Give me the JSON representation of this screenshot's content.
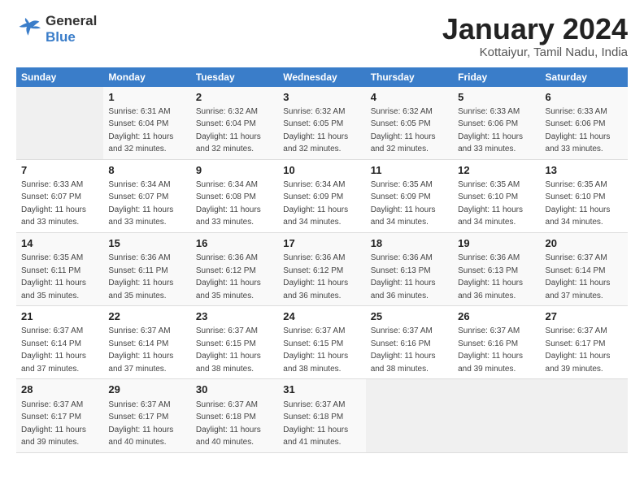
{
  "header": {
    "logo_line1": "General",
    "logo_line2": "Blue",
    "month_title": "January 2024",
    "subtitle": "Kottaiyur, Tamil Nadu, India"
  },
  "weekdays": [
    "Sunday",
    "Monday",
    "Tuesday",
    "Wednesday",
    "Thursday",
    "Friday",
    "Saturday"
  ],
  "weeks": [
    [
      {
        "num": "",
        "empty": true
      },
      {
        "num": "1",
        "sunrise": "Sunrise: 6:31 AM",
        "sunset": "Sunset: 6:04 PM",
        "daylight": "Daylight: 11 hours and 32 minutes."
      },
      {
        "num": "2",
        "sunrise": "Sunrise: 6:32 AM",
        "sunset": "Sunset: 6:04 PM",
        "daylight": "Daylight: 11 hours and 32 minutes."
      },
      {
        "num": "3",
        "sunrise": "Sunrise: 6:32 AM",
        "sunset": "Sunset: 6:05 PM",
        "daylight": "Daylight: 11 hours and 32 minutes."
      },
      {
        "num": "4",
        "sunrise": "Sunrise: 6:32 AM",
        "sunset": "Sunset: 6:05 PM",
        "daylight": "Daylight: 11 hours and 32 minutes."
      },
      {
        "num": "5",
        "sunrise": "Sunrise: 6:33 AM",
        "sunset": "Sunset: 6:06 PM",
        "daylight": "Daylight: 11 hours and 33 minutes."
      },
      {
        "num": "6",
        "sunrise": "Sunrise: 6:33 AM",
        "sunset": "Sunset: 6:06 PM",
        "daylight": "Daylight: 11 hours and 33 minutes."
      }
    ],
    [
      {
        "num": "7",
        "sunrise": "Sunrise: 6:33 AM",
        "sunset": "Sunset: 6:07 PM",
        "daylight": "Daylight: 11 hours and 33 minutes."
      },
      {
        "num": "8",
        "sunrise": "Sunrise: 6:34 AM",
        "sunset": "Sunset: 6:07 PM",
        "daylight": "Daylight: 11 hours and 33 minutes."
      },
      {
        "num": "9",
        "sunrise": "Sunrise: 6:34 AM",
        "sunset": "Sunset: 6:08 PM",
        "daylight": "Daylight: 11 hours and 33 minutes."
      },
      {
        "num": "10",
        "sunrise": "Sunrise: 6:34 AM",
        "sunset": "Sunset: 6:09 PM",
        "daylight": "Daylight: 11 hours and 34 minutes."
      },
      {
        "num": "11",
        "sunrise": "Sunrise: 6:35 AM",
        "sunset": "Sunset: 6:09 PM",
        "daylight": "Daylight: 11 hours and 34 minutes."
      },
      {
        "num": "12",
        "sunrise": "Sunrise: 6:35 AM",
        "sunset": "Sunset: 6:10 PM",
        "daylight": "Daylight: 11 hours and 34 minutes."
      },
      {
        "num": "13",
        "sunrise": "Sunrise: 6:35 AM",
        "sunset": "Sunset: 6:10 PM",
        "daylight": "Daylight: 11 hours and 34 minutes."
      }
    ],
    [
      {
        "num": "14",
        "sunrise": "Sunrise: 6:35 AM",
        "sunset": "Sunset: 6:11 PM",
        "daylight": "Daylight: 11 hours and 35 minutes."
      },
      {
        "num": "15",
        "sunrise": "Sunrise: 6:36 AM",
        "sunset": "Sunset: 6:11 PM",
        "daylight": "Daylight: 11 hours and 35 minutes."
      },
      {
        "num": "16",
        "sunrise": "Sunrise: 6:36 AM",
        "sunset": "Sunset: 6:12 PM",
        "daylight": "Daylight: 11 hours and 35 minutes."
      },
      {
        "num": "17",
        "sunrise": "Sunrise: 6:36 AM",
        "sunset": "Sunset: 6:12 PM",
        "daylight": "Daylight: 11 hours and 36 minutes."
      },
      {
        "num": "18",
        "sunrise": "Sunrise: 6:36 AM",
        "sunset": "Sunset: 6:13 PM",
        "daylight": "Daylight: 11 hours and 36 minutes."
      },
      {
        "num": "19",
        "sunrise": "Sunrise: 6:36 AM",
        "sunset": "Sunset: 6:13 PM",
        "daylight": "Daylight: 11 hours and 36 minutes."
      },
      {
        "num": "20",
        "sunrise": "Sunrise: 6:37 AM",
        "sunset": "Sunset: 6:14 PM",
        "daylight": "Daylight: 11 hours and 37 minutes."
      }
    ],
    [
      {
        "num": "21",
        "sunrise": "Sunrise: 6:37 AM",
        "sunset": "Sunset: 6:14 PM",
        "daylight": "Daylight: 11 hours and 37 minutes."
      },
      {
        "num": "22",
        "sunrise": "Sunrise: 6:37 AM",
        "sunset": "Sunset: 6:14 PM",
        "daylight": "Daylight: 11 hours and 37 minutes."
      },
      {
        "num": "23",
        "sunrise": "Sunrise: 6:37 AM",
        "sunset": "Sunset: 6:15 PM",
        "daylight": "Daylight: 11 hours and 38 minutes."
      },
      {
        "num": "24",
        "sunrise": "Sunrise: 6:37 AM",
        "sunset": "Sunset: 6:15 PM",
        "daylight": "Daylight: 11 hours and 38 minutes."
      },
      {
        "num": "25",
        "sunrise": "Sunrise: 6:37 AM",
        "sunset": "Sunset: 6:16 PM",
        "daylight": "Daylight: 11 hours and 38 minutes."
      },
      {
        "num": "26",
        "sunrise": "Sunrise: 6:37 AM",
        "sunset": "Sunset: 6:16 PM",
        "daylight": "Daylight: 11 hours and 39 minutes."
      },
      {
        "num": "27",
        "sunrise": "Sunrise: 6:37 AM",
        "sunset": "Sunset: 6:17 PM",
        "daylight": "Daylight: 11 hours and 39 minutes."
      }
    ],
    [
      {
        "num": "28",
        "sunrise": "Sunrise: 6:37 AM",
        "sunset": "Sunset: 6:17 PM",
        "daylight": "Daylight: 11 hours and 39 minutes."
      },
      {
        "num": "29",
        "sunrise": "Sunrise: 6:37 AM",
        "sunset": "Sunset: 6:17 PM",
        "daylight": "Daylight: 11 hours and 40 minutes."
      },
      {
        "num": "30",
        "sunrise": "Sunrise: 6:37 AM",
        "sunset": "Sunset: 6:18 PM",
        "daylight": "Daylight: 11 hours and 40 minutes."
      },
      {
        "num": "31",
        "sunrise": "Sunrise: 6:37 AM",
        "sunset": "Sunset: 6:18 PM",
        "daylight": "Daylight: 11 hours and 41 minutes."
      },
      {
        "num": "",
        "empty": true
      },
      {
        "num": "",
        "empty": true
      },
      {
        "num": "",
        "empty": true
      }
    ]
  ]
}
